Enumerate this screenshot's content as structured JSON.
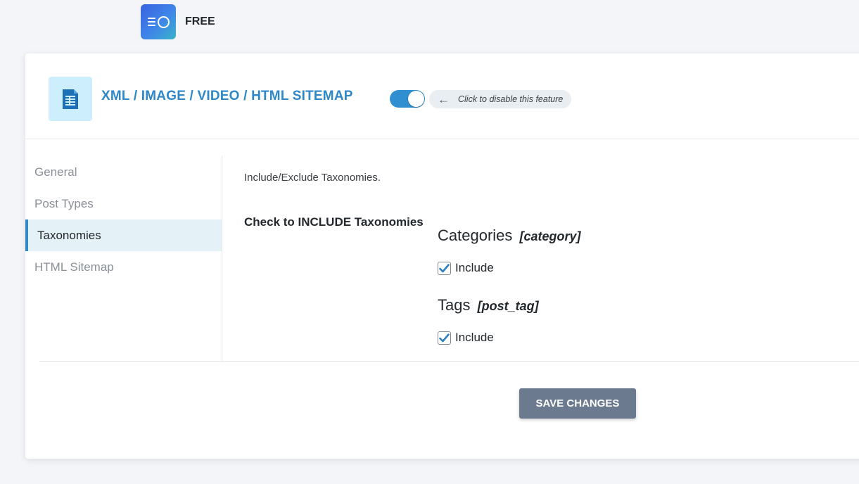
{
  "brand": {
    "plan_label": "FREE"
  },
  "feature": {
    "title": "XML / IMAGE / VIDEO / HTML SITEMAP",
    "toggle_hint": "Click to disable this feature",
    "enabled": true
  },
  "sidebar": {
    "items": [
      {
        "label": "General",
        "active": false
      },
      {
        "label": "Post Types",
        "active": false
      },
      {
        "label": "Taxonomies",
        "active": true
      },
      {
        "label": "HTML Sitemap",
        "active": false
      }
    ]
  },
  "main": {
    "description": "Include/Exclude Taxonomies.",
    "check_label": "Check to INCLUDE Taxonomies",
    "taxonomies": [
      {
        "name": "Categories",
        "slug": "[category]",
        "checkbox_label": "Include",
        "checked": true
      },
      {
        "name": "Tags",
        "slug": "[post_tag]",
        "checkbox_label": "Include",
        "checked": true
      }
    ]
  },
  "footer": {
    "save_label": "SAVE CHANGES"
  },
  "colors": {
    "accent": "#2e87c7",
    "toggle_on": "#2f8fd0",
    "save_button": "#6c7a8f",
    "active_tab_bg": "#e4f1f7"
  },
  "icons": {
    "logo": "seo-logo-icon",
    "feature": "sitemap-document-icon",
    "hint": "arrow-left-icon",
    "checkbox": "checkmark-icon"
  }
}
